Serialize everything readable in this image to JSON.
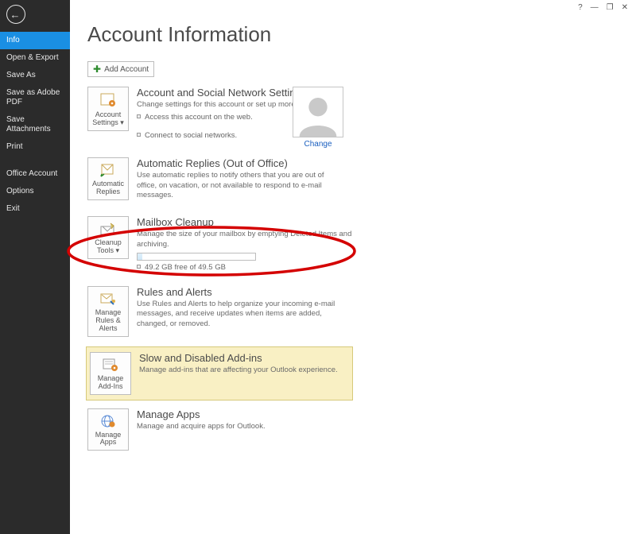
{
  "titlebar": {
    "help": "?",
    "minimize": "—",
    "maximize": "❐",
    "close": "✕"
  },
  "sidebar": {
    "back": "←",
    "items": [
      {
        "label": "Info",
        "active": true
      },
      {
        "label": "Open & Export"
      },
      {
        "label": "Save As"
      },
      {
        "label": "Save as Adobe PDF"
      },
      {
        "label": "Save Attachments"
      },
      {
        "label": "Print"
      }
    ],
    "lower": [
      {
        "label": "Office Account"
      },
      {
        "label": "Options"
      },
      {
        "label": "Exit"
      }
    ]
  },
  "page": {
    "title": "Account Information",
    "addAccount": "Add Account",
    "changeLink": "Change"
  },
  "sections": {
    "accountSettings": {
      "btn": "Account Settings ▾",
      "title": "Account and Social Network Settings",
      "desc": "Change settings for this account or set up more connections.",
      "b1": "Access this account on the web.",
      "b2": "Connect to social networks."
    },
    "autoReply": {
      "btn": "Automatic Replies",
      "title": "Automatic Replies (Out of Office)",
      "desc": "Use automatic replies to notify others that you are out of office, on vacation, or not available to respond to e-mail messages."
    },
    "cleanup": {
      "btn": "Cleanup Tools ▾",
      "title": "Mailbox Cleanup",
      "desc": "Manage the size of your mailbox by emptying Deleted Items and archiving.",
      "free": "49.2 GB free of 49.5 GB"
    },
    "rules": {
      "btn": "Manage Rules & Alerts",
      "title": "Rules and Alerts",
      "desc": "Use Rules and Alerts to help organize your incoming e-mail messages, and receive updates when items are added, changed, or removed."
    },
    "addins": {
      "btn": "Manage Add-Ins",
      "title": "Slow and Disabled Add-ins",
      "desc": "Manage add-ins that are affecting your Outlook experience."
    },
    "apps": {
      "btn": "Manage Apps",
      "title": "Manage Apps",
      "desc": "Manage and acquire apps for Outlook."
    }
  }
}
